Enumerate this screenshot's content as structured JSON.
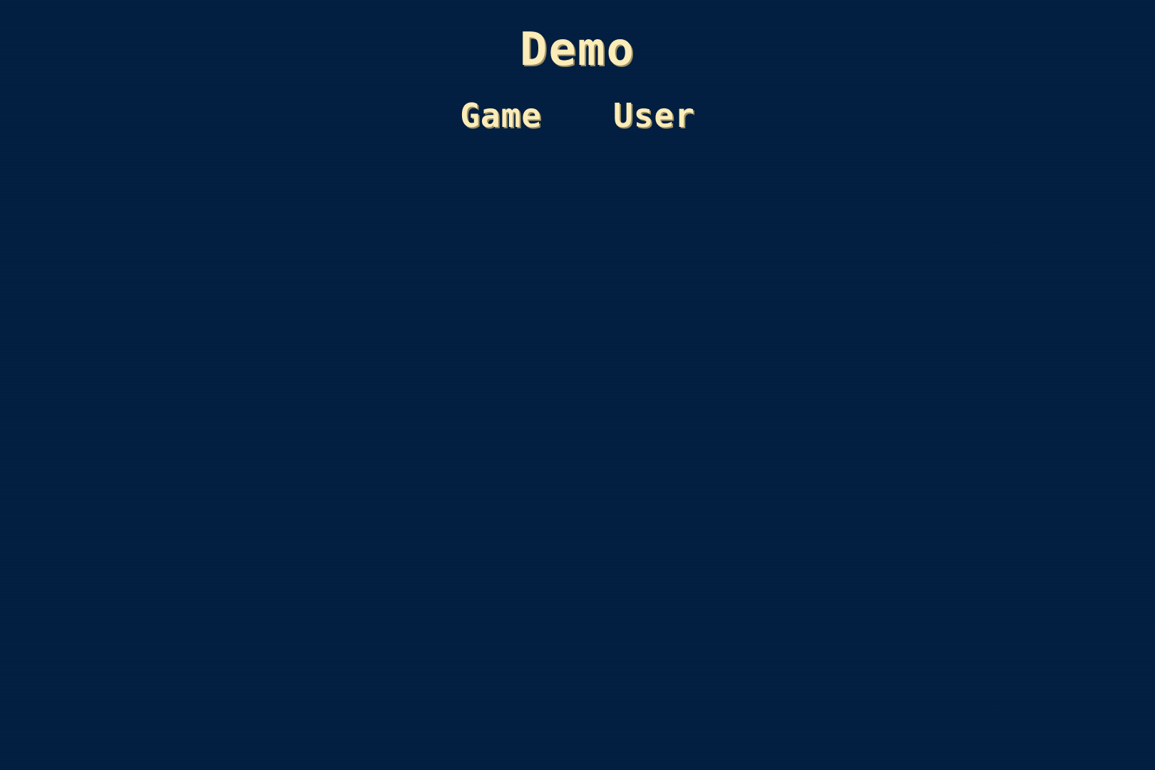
{
  "app": {
    "title": "Demo"
  },
  "nav": {
    "items": [
      {
        "label": "Game"
      },
      {
        "label": "User"
      }
    ]
  },
  "colors": {
    "background": "#011e41",
    "text": "#fbecb8"
  }
}
